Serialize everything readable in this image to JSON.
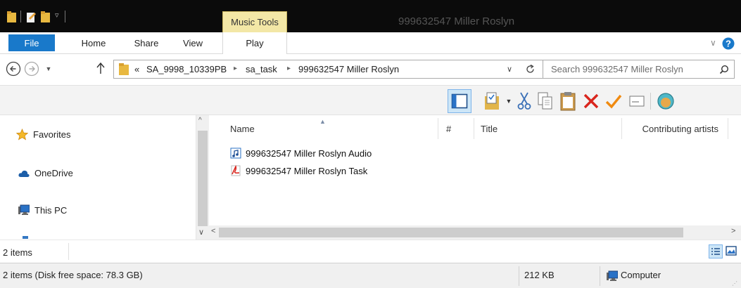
{
  "window": {
    "title": "999632547 Miller Roslyn",
    "contextual_tab": "Music Tools"
  },
  "ribbon": {
    "tabs": [
      "File",
      "Home",
      "Share",
      "View",
      "Play"
    ]
  },
  "address": {
    "overflow_marker": "«",
    "path": [
      "SA_9998_10339PB",
      "sa_task",
      "999632547 Miller Roslyn"
    ],
    "search_placeholder": "Search 999632547 Miller Roslyn"
  },
  "nav": {
    "items": [
      {
        "label": "Favorites",
        "icon": "star-icon"
      },
      {
        "label": "OneDrive",
        "icon": "cloud-icon"
      },
      {
        "label": "This PC",
        "icon": "computer-icon"
      }
    ]
  },
  "columns": [
    "Name",
    "#",
    "Title",
    "Contributing artists"
  ],
  "files": [
    {
      "name": "999632547 Miller Roslyn Audio",
      "icon": "audio-file-icon"
    },
    {
      "name": "999632547 Miller Roslyn Task",
      "icon": "pdf-file-icon"
    }
  ],
  "status": {
    "count": "2 items"
  },
  "details": {
    "summary": "2 items (Disk free space: 78.3 GB)",
    "size": "212 KB",
    "location": "Computer"
  },
  "colors": {
    "file_tab": "#1979ca",
    "context_tab": "#f3e7a6",
    "title_bar": "#0b0b0b",
    "delete": "#d9251d",
    "check": "#f08a10"
  }
}
